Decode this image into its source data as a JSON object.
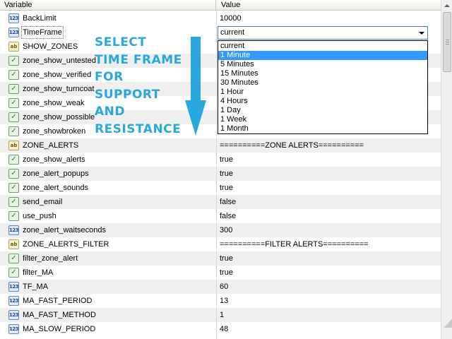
{
  "header": {
    "col_variable": "Variable",
    "col_value": "Value"
  },
  "rows": [
    {
      "icon": "123",
      "name": "BackLimit",
      "value": "10000"
    },
    {
      "icon": "123",
      "name": "TimeFrame",
      "value": "current"
    },
    {
      "icon": "ab",
      "name": "SHOW_ZONES",
      "value": ""
    },
    {
      "icon": "bool",
      "name": "zone_show_untested",
      "value": ""
    },
    {
      "icon": "bool",
      "name": "zone_show_verified",
      "value": ""
    },
    {
      "icon": "bool",
      "name": "zone_show_turncoat",
      "value": ""
    },
    {
      "icon": "bool",
      "name": "zone_show_weak",
      "value": ""
    },
    {
      "icon": "bool",
      "name": "zone_show_possible",
      "value": ""
    },
    {
      "icon": "bool",
      "name": "zone_showbroken",
      "value": ""
    },
    {
      "icon": "ab",
      "name": "ZONE_ALERTS",
      "value": "==========ZONE ALERTS=========="
    },
    {
      "icon": "bool",
      "name": "zone_show_alerts",
      "value": "true"
    },
    {
      "icon": "bool",
      "name": "zone_alert_popups",
      "value": "true"
    },
    {
      "icon": "bool",
      "name": "zone_alert_sounds",
      "value": "true"
    },
    {
      "icon": "bool",
      "name": "send_email",
      "value": "false"
    },
    {
      "icon": "bool",
      "name": "use_push",
      "value": "false"
    },
    {
      "icon": "123",
      "name": "zone_alert_waitseconds",
      "value": "300"
    },
    {
      "icon": "ab",
      "name": "ZONE_ALERTS_FILTER",
      "value": "==========FILTER ALERTS=========="
    },
    {
      "icon": "bool",
      "name": "filter_zone_alert",
      "value": "true"
    },
    {
      "icon": "bool",
      "name": "filter_MA",
      "value": "true"
    },
    {
      "icon": "123",
      "name": "TF_MA",
      "value": "60"
    },
    {
      "icon": "123",
      "name": "MA_FAST_PERIOD",
      "value": "13"
    },
    {
      "icon": "123",
      "name": "MA_FAST_METHOD",
      "value": "1"
    },
    {
      "icon": "123",
      "name": "MA_SLOW_PERIOD",
      "value": "48"
    }
  ],
  "icon_labels": {
    "num": "123",
    "str": "ab",
    "bool": "✓"
  },
  "dropdown": {
    "selected": "current",
    "highlighted_index": 1,
    "options": [
      "current",
      "1 Minute",
      "5 Minutes",
      "15 Minutes",
      "30 Minutes",
      "1 Hour",
      "4 Hours",
      "1 Day",
      "1 Week",
      "1 Month"
    ]
  },
  "overlay": {
    "lines": [
      "SELECT",
      "TIME FRAME",
      "FOR",
      "SUPPORT",
      "AND",
      "RESISTANCE"
    ],
    "color": "#29a8e0"
  },
  "colors": {
    "highlight": "#3399ff",
    "alt_row": "#efefef"
  }
}
